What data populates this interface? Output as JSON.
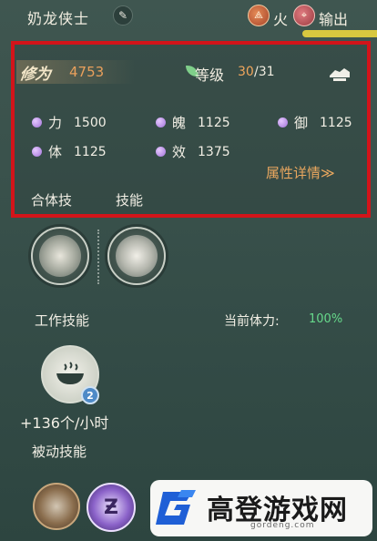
{
  "header": {
    "name": "奶龙侠士",
    "element_icon_glyph": "⟁",
    "element_label": "火",
    "role_icon_glyph": "⌖",
    "role_label": "输出"
  },
  "panel": {
    "power_label": "修为",
    "power_value": "4753",
    "level_label": "等级",
    "level_current": "30",
    "level_max": "/31",
    "stats": [
      {
        "name": "力",
        "value": "1500"
      },
      {
        "name": "魄",
        "value": "1125"
      },
      {
        "name": "御",
        "value": "1125"
      },
      {
        "name": "体",
        "value": "1125"
      },
      {
        "name": "效",
        "value": "1375"
      }
    ],
    "detail_link": "属性详情≫",
    "tabs": [
      "合体技",
      "技能"
    ]
  },
  "work": {
    "label": "工作技能",
    "stamina_label": "当前体力:",
    "stamina_value": "100%",
    "badge": "2",
    "rate": "+136个/小时"
  },
  "passive": {
    "label": "被动技能",
    "second_glyph": "Ƶ"
  },
  "watermark": {
    "title": "高登游戏网",
    "url": "gordeng.com"
  },
  "colors": {
    "accent_orange": "#e9a75f",
    "stamina_green": "#66d98b",
    "highlight_red": "#d3141a"
  }
}
